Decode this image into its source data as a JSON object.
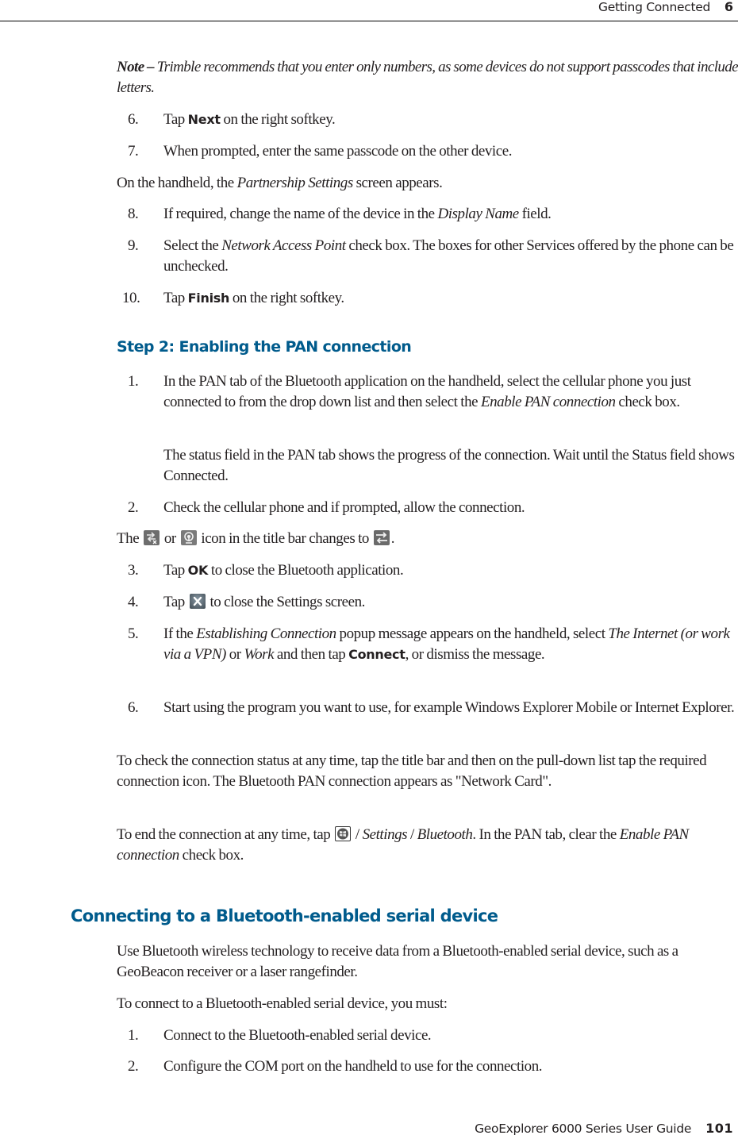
{
  "header": {
    "section_title": "Getting Connected",
    "chapter_number": "6"
  },
  "footer": {
    "guide_title": "GeoExplorer 6000 Series User Guide",
    "page_number": "101"
  },
  "note": {
    "label": "Note –",
    "text": "Trimble recommends that you enter only numbers, as some devices do not support passcodes that include letters."
  },
  "steps_a": [
    {
      "num": "6.",
      "pre": "Tap ",
      "button": "Next",
      "post": " on the right softkey."
    },
    {
      "num": "7.",
      "text": "When prompted, enter the same passcode on the other device."
    }
  ],
  "partnership_para": {
    "pre": "On the handheld, the ",
    "em": "Partnership Settings",
    "post": " screen appears."
  },
  "steps_b": [
    {
      "num": "8.",
      "pre": "If required, change the name of the device in the ",
      "em": "Display Name",
      "post": " field."
    },
    {
      "num": "9.",
      "pre": "Select the ",
      "em": "Network Access Point",
      "post": " check box.  The boxes for other Services offered by the phone can be unchecked."
    },
    {
      "num": "10.",
      "pre": "Tap ",
      "button": "Finish",
      "post": " on the right softkey."
    }
  ],
  "step2": {
    "heading": "Step 2: Enabling the PAN connection",
    "items": [
      {
        "num": "1.",
        "pre": "In the PAN tab of the Bluetooth application on the handheld, select the cellular phone you just connected to from the drop down list and then select the ",
        "em": "Enable PAN connection",
        "post": " check box.",
        "sub": "The status field in the PAN tab shows the progress of the connection. Wait until the Status field shows Connected."
      },
      {
        "num": "2.",
        "text": "Check the cellular phone and if prompted, allow the connection."
      }
    ],
    "icon_para": {
      "pre": "The ",
      "icon1": "disconnected-network-icon",
      "mid1": " or ",
      "icon2": "connecting-network-icon",
      "mid2": " icon in the title bar changes to",
      "icon3": "connected-network-icon",
      "post": "."
    },
    "items2": [
      {
        "num": "3.",
        "pre": "Tap ",
        "button": "OK",
        "post": " to close the Bluetooth application."
      },
      {
        "num": "4.",
        "pre": "Tap ",
        "icon": "close-icon",
        "post": " to close the Settings screen."
      },
      {
        "num": "5.",
        "pre": "If the ",
        "em1": "Establishing Connection",
        "mid1": " popup message appears on the handheld, select ",
        "em2": "The Internet (or work via a VPN)",
        "mid2": " or ",
        "em3": "Work",
        "mid3": " and then tap ",
        "button": "Connect",
        "post": ", or dismiss the message."
      },
      {
        "num": "6.",
        "text": "Start using the program you want to use, for example Windows Explorer Mobile or Internet Explorer."
      }
    ],
    "check_para": "To check the connection status at any time, tap the title bar and then on the pull-down list tap the required connection icon. The Bluetooth PAN connection appears as \"Network Card\".",
    "end_para": {
      "pre": "To end the connection at any time, tap ",
      "icon": "windows-start-icon",
      "sep1": " / ",
      "em1": "Settings",
      "sep2": " / ",
      "em2": "Bluetooth",
      "mid": ". In the PAN tab, clear the ",
      "em3": "Enable PAN connection",
      "post": " check box."
    }
  },
  "serial": {
    "heading": "Connecting to a Bluetooth-enabled serial device",
    "intro": "Use Bluetooth wireless technology to receive data from a Bluetooth-enabled serial device, such as a GeoBeacon receiver or a laser rangefinder.",
    "lead": "To connect to a Bluetooth-enabled serial device, you must:",
    "items": [
      {
        "num": "1.",
        "text": "Connect to the Bluetooth-enabled serial device."
      },
      {
        "num": "2.",
        "text": "Configure the COM port on the handheld to use for the connection."
      }
    ]
  },
  "colors": {
    "heading": "#005b8c",
    "text": "#231f20",
    "rule": "#000000"
  }
}
